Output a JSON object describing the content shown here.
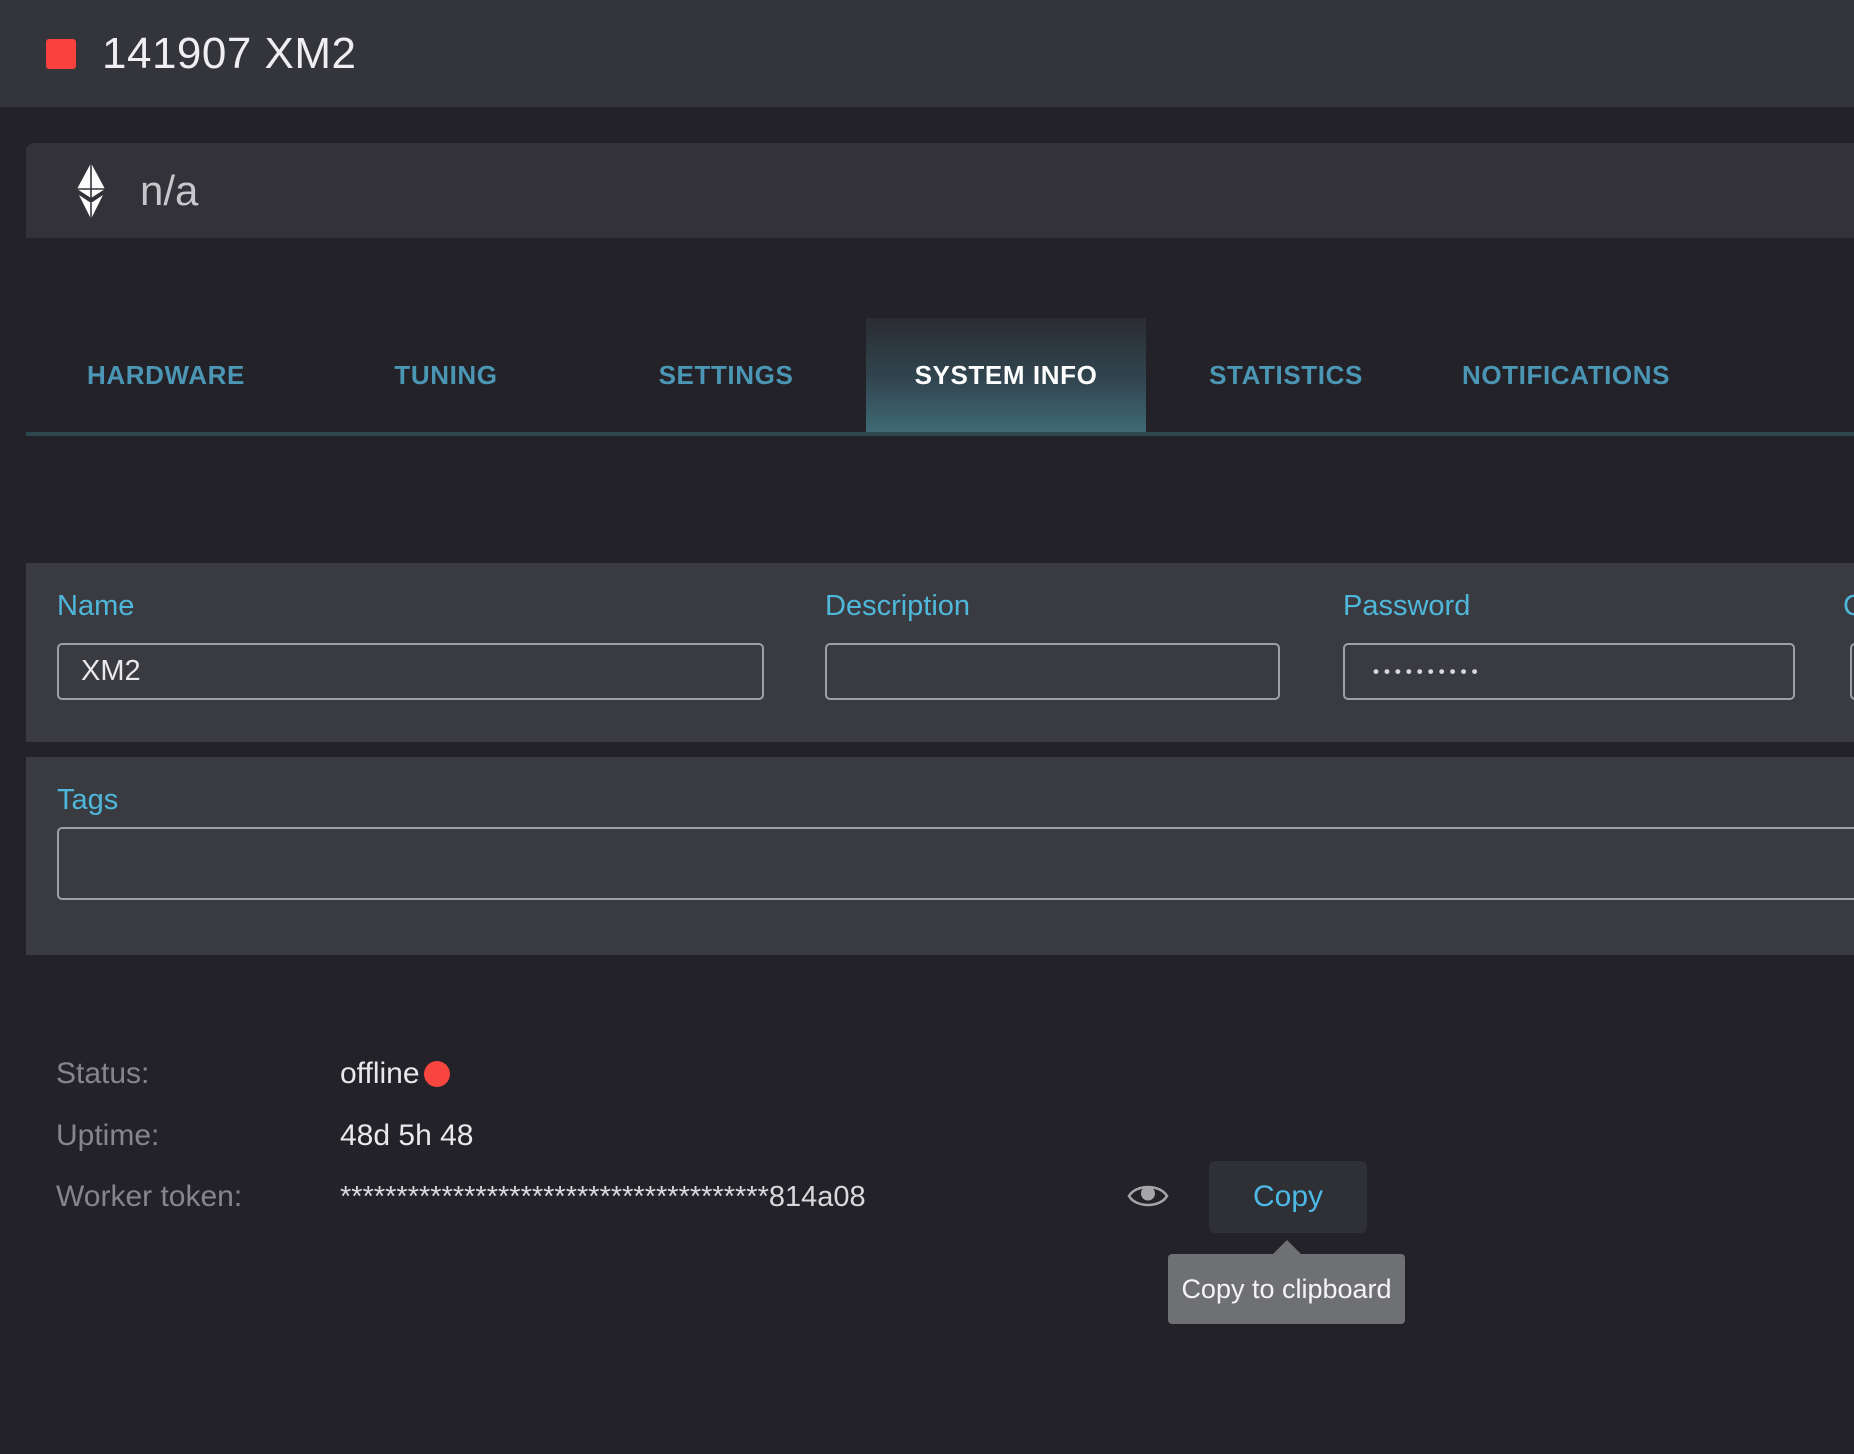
{
  "header": {
    "title": "141907 XM2"
  },
  "coin_bar": {
    "coin_icon": "ethereum-icon",
    "value": "n/a"
  },
  "tabs": [
    {
      "label": "HARDWARE",
      "active": false
    },
    {
      "label": "TUNING",
      "active": false
    },
    {
      "label": "SETTINGS",
      "active": false
    },
    {
      "label": "SYSTEM INFO",
      "active": true
    },
    {
      "label": "STATISTICS",
      "active": false
    },
    {
      "label": "NOTIFICATIONS",
      "active": false
    }
  ],
  "form": {
    "name_label": "Name",
    "name_value": "XM2",
    "description_label": "Description",
    "description_value": "",
    "password_label": "Password",
    "password_mask": "••••••••••",
    "cutoff_label": "C",
    "cutoff_value": "",
    "tags_label": "Tags",
    "tags_value": ""
  },
  "info": {
    "status_label": "Status:",
    "status_value": "offline",
    "status_color": "#f8453e",
    "uptime_label": "Uptime:",
    "uptime_value": "48d 5h 48",
    "token_label": "Worker token:",
    "token_value": "**************************************814a08",
    "copy_label": "Copy",
    "tooltip": "Copy to clipboard"
  },
  "colors": {
    "accent_cyan": "#4fb8da",
    "tab_teal": "#4b96b4",
    "copy_cyan": "#4cb9e6",
    "alert_red": "#f9423e",
    "panel_bg": "#3a3b41",
    "header_bg": "#34353b",
    "page_bg": "#232228",
    "active_tab_gradient_bottom": "#3f6b75"
  }
}
